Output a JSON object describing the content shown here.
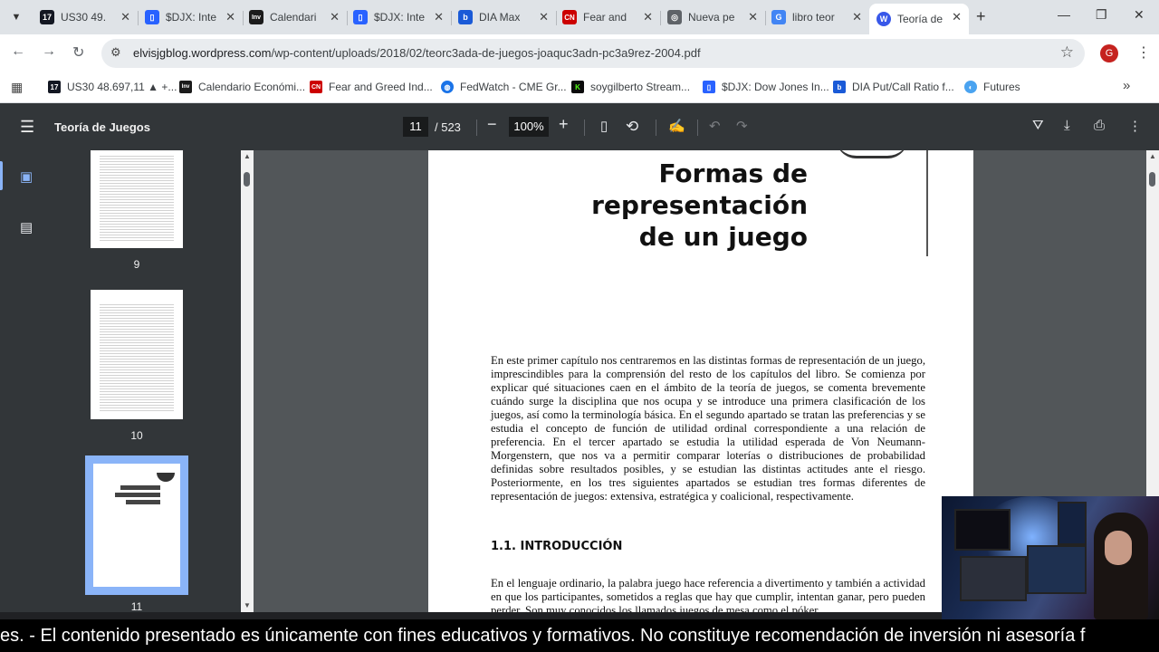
{
  "tabs": [
    {
      "title": "US30 49.",
      "icon": "tradingview-icon",
      "color": "#131722",
      "glyph": "17"
    },
    {
      "title": "$DJX: Inte",
      "icon": "barchart-icon",
      "color": "#2962ff",
      "glyph": "▯"
    },
    {
      "title": "Calendari",
      "icon": "investing-icon",
      "color": "#1b1b1b",
      "glyph": "Inv"
    },
    {
      "title": "$DJX: Inte",
      "icon": "barchart-icon",
      "color": "#2962ff",
      "glyph": "▯"
    },
    {
      "title": "DIA Max",
      "icon": "b-icon",
      "color": "#1a5ad7",
      "glyph": "b"
    },
    {
      "title": "Fear and",
      "icon": "cnn-icon",
      "color": "#cc0000",
      "glyph": "CN"
    },
    {
      "title": "Nueva pe",
      "icon": "chrome-icon",
      "color": "#5f6368",
      "glyph": "◎"
    },
    {
      "title": "libro teor",
      "icon": "google-icon",
      "color": "#4285f4",
      "glyph": "G"
    },
    {
      "title": "Teoría de",
      "icon": "wordpress-icon",
      "color": "#3858e9",
      "glyph": "W"
    }
  ],
  "address": {
    "host": "elvisjgblog.wordpress.com",
    "path": "/wp-content/uploads/2018/02/teorc3ada-de-juegos-joaquc3adn-pc3a9rez-2004.pdf"
  },
  "profile_initial": "G",
  "bookmarks": [
    {
      "label": "US30 48.697,11 ▲ +...",
      "icon": "tradingview-icon",
      "color": "#131722",
      "glyph": "17"
    },
    {
      "label": "Calendario Económi...",
      "icon": "investing-icon",
      "color": "#1b1b1b",
      "glyph": "Inv"
    },
    {
      "label": "Fear and Greed Ind...",
      "icon": "cnn-icon",
      "color": "#cc0000",
      "glyph": "CN"
    },
    {
      "label": "FedWatch - CME Gr...",
      "icon": "globe-icon",
      "color": "#1a73e8",
      "glyph": "◍"
    },
    {
      "label": "soygilberto Stream...",
      "icon": "kick-icon",
      "color": "#0b0b0b",
      "glyph": "K"
    },
    {
      "label": "$DJX: Dow Jones In...",
      "icon": "barchart-icon",
      "color": "#2962ff",
      "glyph": "▯"
    },
    {
      "label": "DIA Put/Call Ratio f...",
      "icon": "b-icon",
      "color": "#1a5ad7",
      "glyph": "b"
    },
    {
      "label": "Futures",
      "icon": "futures-icon",
      "color": "#4aa3f0",
      "glyph": "◐"
    }
  ],
  "pdf": {
    "title": "Teoría de Juegos",
    "page": "11",
    "total": "/ 523",
    "zoom": "100%"
  },
  "thumbnails": [
    "9",
    "10",
    "11"
  ],
  "document": {
    "chapter_title": [
      "Formas de",
      "representación",
      "de un juego"
    ],
    "intro": "En este primer capítulo nos centraremos en las distintas formas de representación de un juego, imprescindibles para la comprensión del resto de los capítulos del libro. Se comienza por explicar qué situaciones caen en el ámbito de la teoría de juegos, se comenta brevemente cuándo surge la disciplina que nos ocupa y se introduce una primera clasificación de los juegos, así como la terminología básica. En el segundo apartado se tratan las preferencias y se estudia el concepto de función de utilidad ordinal correspondiente a una relación de preferencia. En el tercer apartado se estudia la utilidad esperada de Von Neumann-Morgenstern, que nos va a permitir comparar loterías o distribuciones de probabilidad definidas sobre resultados posibles, y se estudian las distintas actitudes ante el riesgo. Posteriormente, en los tres siguientes apartados se estudian tres formas diferentes de representación de juegos: extensiva, estratégica y coalicional, respectivamente.",
    "section": "1.1.   INTRODUCCIÓN",
    "section_text": "En el lenguaje ordinario, la palabra juego hace referencia a divertimento y también a actividad en que los participantes, sometidos a reglas que hay que cumplir, intentan ganar, pero pueden perder. Son muy conocidos los llamados juegos de mesa como el póker"
  },
  "ticker": "es.  - El contenido presentado es únicamente con fines educativos y formativos. No constituye recomendación de inversión ni asesoría f"
}
